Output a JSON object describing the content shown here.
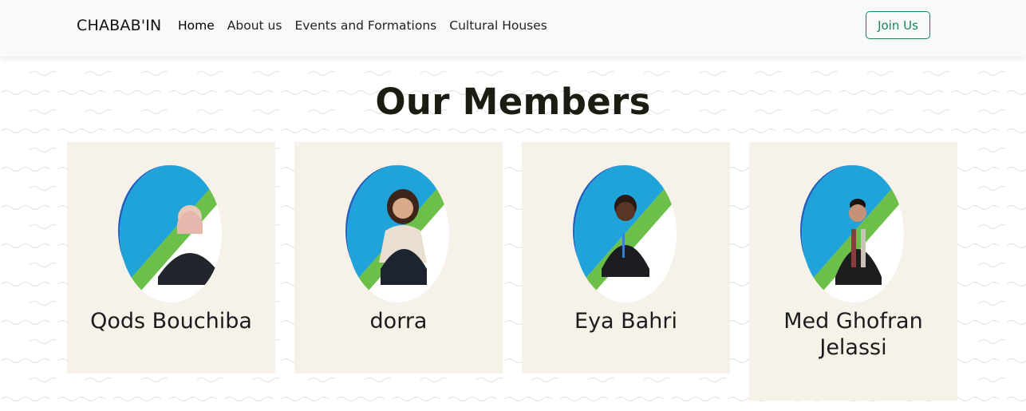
{
  "navbar": {
    "brand": "CHABAB'IN",
    "links": [
      {
        "label": "Home",
        "active": true
      },
      {
        "label": "About us",
        "active": false
      },
      {
        "label": "Events and Formations",
        "active": false
      },
      {
        "label": "Cultural Houses",
        "active": false
      }
    ],
    "join_label": "Join Us"
  },
  "main": {
    "title": "Our Members",
    "members": [
      {
        "name": "Qods Bouchiba"
      },
      {
        "name": "dorra"
      },
      {
        "name": "Eya Bahri"
      },
      {
        "name": "Med Ghofran Jelassi"
      }
    ]
  },
  "colors": {
    "accent_green": "#198754",
    "card_bg": "#f6f2ea",
    "avatar_blue": "#1fa3d8",
    "avatar_stripe_green": "#6cc04a"
  }
}
